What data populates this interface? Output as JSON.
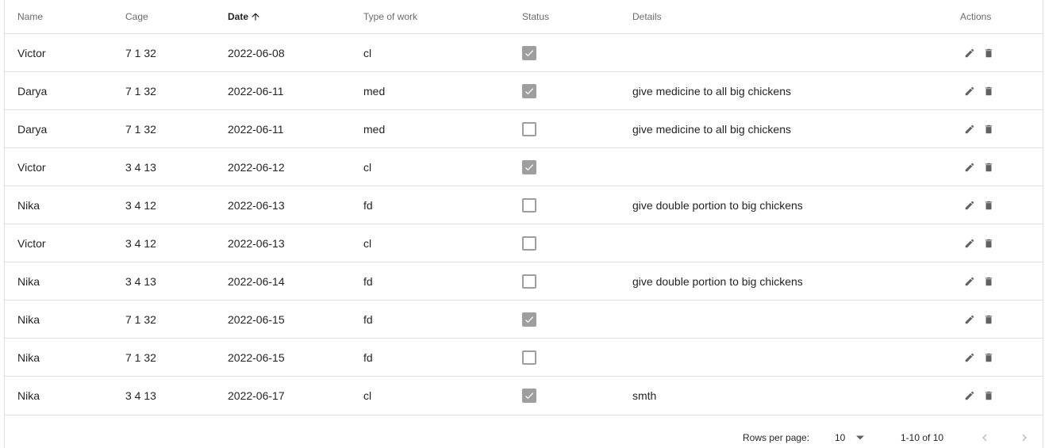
{
  "columns": {
    "name": "Name",
    "cage": "Cage",
    "date": "Date",
    "type": "Type of work",
    "status": "Status",
    "details": "Details",
    "actions": "Actions"
  },
  "sort": {
    "column": "date",
    "direction": "asc",
    "icon": "arrow-up-icon"
  },
  "rows": [
    {
      "name": "Victor",
      "cage": "7 1 32",
      "date": "2022-06-08",
      "type": "cl",
      "status": true,
      "details": ""
    },
    {
      "name": "Darya",
      "cage": "7 1 32",
      "date": "2022-06-11",
      "type": "med",
      "status": true,
      "details": "give medicine to all big chickens"
    },
    {
      "name": "Darya",
      "cage": "7 1 32",
      "date": "2022-06-11",
      "type": "med",
      "status": false,
      "details": "give medicine to all big chickens"
    },
    {
      "name": "Victor",
      "cage": "3 4 13",
      "date": "2022-06-12",
      "type": "cl",
      "status": true,
      "details": ""
    },
    {
      "name": "Nika",
      "cage": "3 4 12",
      "date": "2022-06-13",
      "type": "fd",
      "status": false,
      "details": "give double portion to big chickens"
    },
    {
      "name": "Victor",
      "cage": "3 4 12",
      "date": "2022-06-13",
      "type": "cl",
      "status": false,
      "details": ""
    },
    {
      "name": "Nika",
      "cage": "3 4 13",
      "date": "2022-06-14",
      "type": "fd",
      "status": false,
      "details": "give double portion to big chickens"
    },
    {
      "name": "Nika",
      "cage": "7 1 32",
      "date": "2022-06-15",
      "type": "fd",
      "status": true,
      "details": ""
    },
    {
      "name": "Nika",
      "cage": "7 1 32",
      "date": "2022-06-15",
      "type": "fd",
      "status": false,
      "details": ""
    },
    {
      "name": "Nika",
      "cage": "3 4 13",
      "date": "2022-06-17",
      "type": "cl",
      "status": true,
      "details": "smth"
    }
  ],
  "actions": {
    "edit_icon": "pencil-icon",
    "delete_icon": "trash-icon"
  },
  "pagination": {
    "rows_per_page_label": "Rows per page:",
    "rows_per_page_value": "10",
    "range_label": "1-10 of 10"
  },
  "colors": {
    "border": "#e0e0e0",
    "checkbox": "#9e9e9e",
    "icon": "#616161"
  }
}
